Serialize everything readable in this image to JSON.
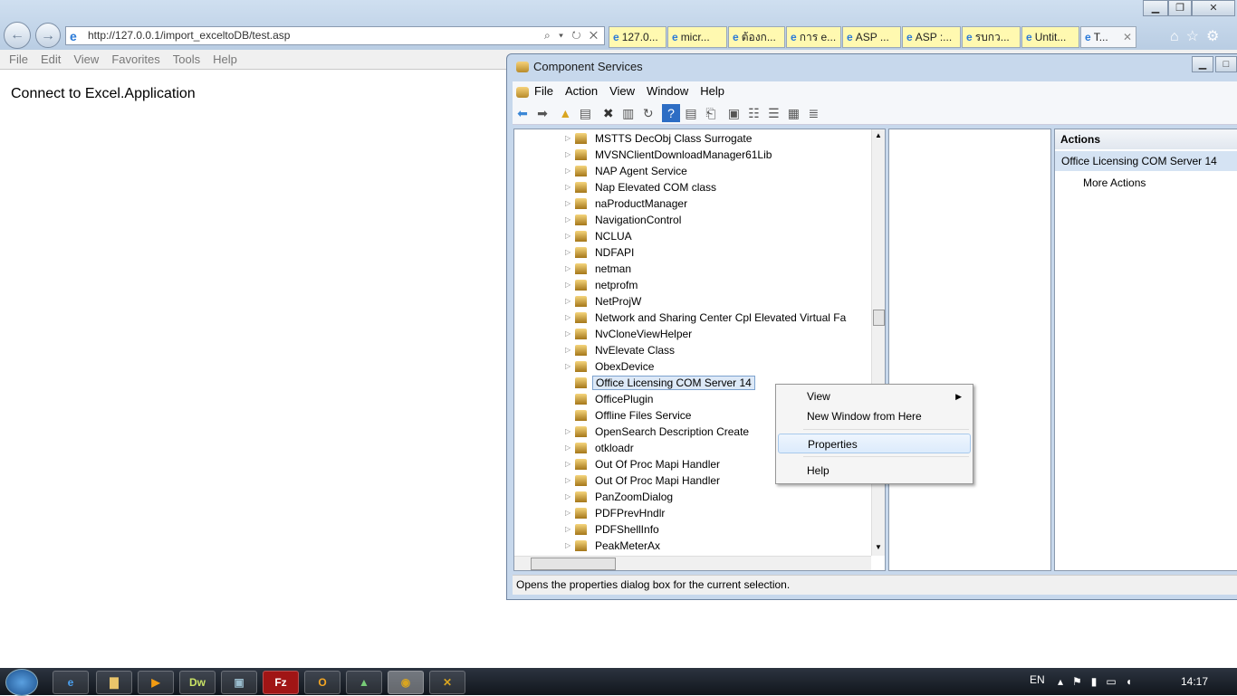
{
  "browser": {
    "url": "http://127.0.0.1/import_exceltoDB/test.asp",
    "address_controls": "⌕ ▾ ↻ ✕",
    "tabs": [
      {
        "label": "127.0..."
      },
      {
        "label": "micr..."
      },
      {
        "label": "ต้องก..."
      },
      {
        "label": "การ e..."
      },
      {
        "label": "ASP ..."
      },
      {
        "label": "ASP :..."
      },
      {
        "label": "รบกว..."
      },
      {
        "label": "Untit..."
      },
      {
        "label": "T..."
      }
    ],
    "menu": [
      "File",
      "Edit",
      "View",
      "Favorites",
      "Tools",
      "Help"
    ],
    "page_text": "Connect to Excel.Application"
  },
  "cs": {
    "title": "Component Services",
    "menu": [
      "File",
      "Action",
      "View",
      "Window",
      "Help"
    ],
    "tree": [
      "MSTTS DecObj Class Surrogate",
      "MVSNClientDownloadManager61Lib",
      "NAP Agent Service",
      "Nap Elevated COM class",
      "naProductManager",
      "NavigationControl",
      "NCLUA",
      "NDFAPI",
      "netman",
      "netprofm",
      "NetProjW",
      "Network and Sharing Center Cpl Elevated Virtual Fa",
      "NvCloneViewHelper",
      "NvElevate Class",
      "ObexDevice",
      "Office Licensing COM Server 14",
      "OfficePlugin",
      "Offline Files Service",
      "OpenSearch Description Create",
      "otkloadr",
      "Out Of Proc Mapi Handler",
      "Out Of Proc Mapi Handler",
      "PanZoomDialog",
      "PDFPrevHndlr",
      "PDFShellInfo",
      "PeakMeterAx"
    ],
    "selected_index": 15,
    "actions": {
      "header": "Actions",
      "selected": "Office Licensing COM Server 14",
      "more": "More Actions"
    },
    "status": "Opens the properties dialog box for the current selection.",
    "context_menu": [
      "View",
      "New Window from Here",
      "Properties",
      "Help"
    ]
  },
  "taskbar": {
    "lang": "EN",
    "time": "14:17"
  }
}
